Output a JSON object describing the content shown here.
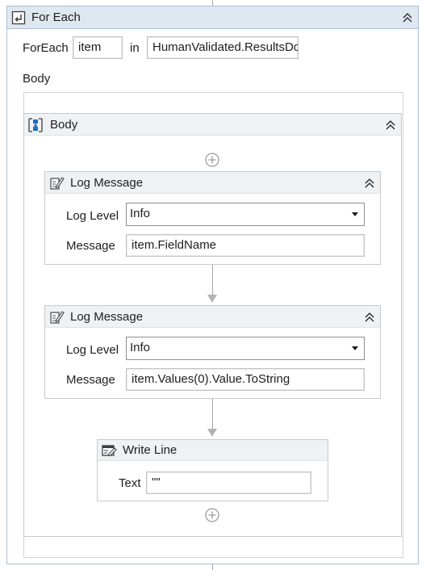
{
  "foreach": {
    "title": "For Each",
    "icon": "foreach-icon",
    "foreach_label": "ForEach",
    "item_value": "item",
    "in_label": "in",
    "collection_value": "HumanValidated.ResultsDocument",
    "body_label": "Body"
  },
  "sequence": {
    "title": "Body",
    "icon": "sequence-icon"
  },
  "log_messages": [
    {
      "title": "Log Message",
      "icon": "log-message-icon",
      "level_label": "Log Level",
      "level_value": "Info",
      "message_label": "Message",
      "message_value": "item.FieldName"
    },
    {
      "title": "Log Message",
      "icon": "log-message-icon",
      "level_label": "Log Level",
      "level_value": "Info",
      "message_label": "Message",
      "message_value": "item.Values(0).Value.ToString"
    }
  ],
  "write_line": {
    "title": "Write Line",
    "icon": "write-line-icon",
    "text_label": "Text",
    "text_value": "\"\""
  },
  "colors": {
    "header_bg": "#dfe8f1",
    "header_border": "#a9bed3",
    "activity_header_bg": "#eff2f5",
    "connector": "#a6a6a6",
    "accent_blue": "#1e6fbf"
  }
}
